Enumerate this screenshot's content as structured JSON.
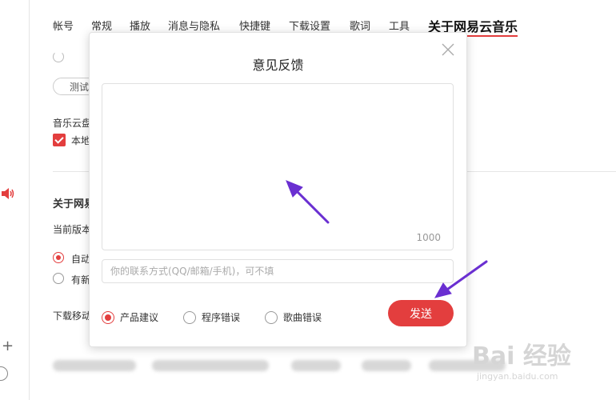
{
  "settings": {
    "tabs": [
      {
        "label": "帐号"
      },
      {
        "label": "常规"
      },
      {
        "label": "播放"
      },
      {
        "label": "消息与隐私"
      },
      {
        "label": "快捷键"
      },
      {
        "label": "下载设置"
      },
      {
        "label": "歌词"
      },
      {
        "label": "工具"
      },
      {
        "label": "关于网易云音乐",
        "active": true
      }
    ],
    "test_button": "测试",
    "cloud_label": "音乐云盘",
    "local_checkbox_label": "本地",
    "about_heading": "关于网易",
    "current_version_label": "当前版本",
    "auto_update_label": "自动",
    "new_version_label": "有新",
    "download_mobile_label": "下载移动"
  },
  "feedback_dialog": {
    "title": "意见反馈",
    "char_limit": "1000",
    "feedback_text": "",
    "contact_placeholder": "你的联系方式(QQ/邮箱/手机)，可不填",
    "options": [
      {
        "label": "产品建议",
        "selected": true
      },
      {
        "label": "程序错误",
        "selected": false
      },
      {
        "label": "歌曲错误",
        "selected": false
      }
    ],
    "send_label": "发送"
  },
  "watermark": {
    "logo": "Bai 经验",
    "url": "jingyan.baidu.com"
  },
  "colors": {
    "accent": "#e33e3e",
    "annotation_arrow": "#6a2fd1"
  }
}
